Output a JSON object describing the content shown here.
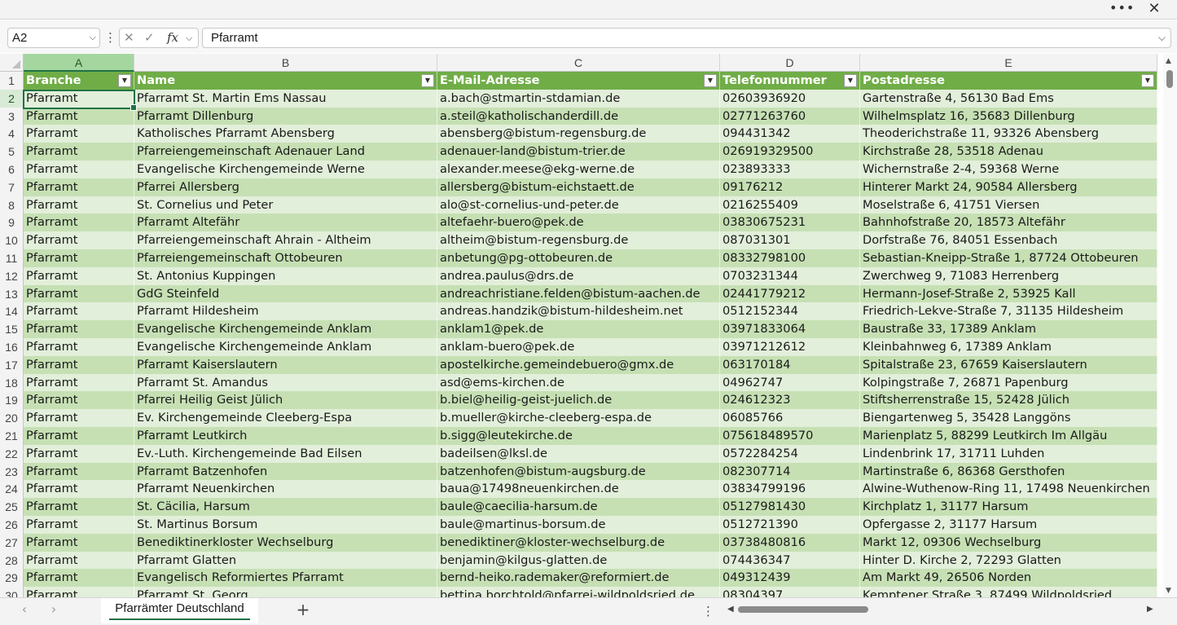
{
  "window": {
    "more_icon": "more-horizontal-icon",
    "close_icon": "close-icon"
  },
  "formula_bar": {
    "name_box": "A2",
    "fx_label": "fx",
    "formula": "Pfarramt"
  },
  "columns": [
    "A",
    "B",
    "C",
    "D",
    "E"
  ],
  "headers": [
    "Branche",
    "Name",
    "E-Mail-Adresse",
    "Telefonnummer",
    "Postadresse"
  ],
  "rows": [
    {
      "n": "2",
      "a": "Pfarramt",
      "b": "Pfarramt St. Martin Ems Nassau",
      "c": "a.bach@stmartin-stdamian.de",
      "d": "02603936920",
      "e": "Gartenstraße 4, 56130 Bad Ems"
    },
    {
      "n": "3",
      "a": "Pfarramt",
      "b": "Pfarramt Dillenburg",
      "c": "a.steil@katholischanderdill.de",
      "d": "02771263760",
      "e": "Wilhelmsplatz 16, 35683 Dillenburg"
    },
    {
      "n": "4",
      "a": "Pfarramt",
      "b": "Katholisches Pfarramt Abensberg",
      "c": "abensberg@bistum-regensburg.de",
      "d": "094431342",
      "e": "Theoderichstraße 11, 93326 Abensberg"
    },
    {
      "n": "5",
      "a": "Pfarramt",
      "b": "Pfarreiengemeinschaft Adenauer Land",
      "c": "adenauer-land@bistum-trier.de",
      "d": "026919329500",
      "e": "Kirchstraße 28, 53518 Adenau"
    },
    {
      "n": "6",
      "a": "Pfarramt",
      "b": "Evangelische Kirchengemeinde Werne",
      "c": "alexander.meese@ekg-werne.de",
      "d": "023893333",
      "e": "Wichernstraße 2-4, 59368 Werne"
    },
    {
      "n": "7",
      "a": "Pfarramt",
      "b": "Pfarrei Allersberg",
      "c": "allersberg@bistum-eichstaett.de",
      "d": "09176212",
      "e": "Hinterer Markt 24, 90584 Allersberg"
    },
    {
      "n": "8",
      "a": "Pfarramt",
      "b": "St. Cornelius und Peter",
      "c": "alo@st-cornelius-und-peter.de",
      "d": "0216255409",
      "e": "Moselstraße 6, 41751 Viersen"
    },
    {
      "n": "9",
      "a": "Pfarramt",
      "b": "Pfarramt Altefähr",
      "c": "altefaehr-buero@pek.de",
      "d": "03830675231",
      "e": "Bahnhofstraße 20, 18573 Altefähr"
    },
    {
      "n": "10",
      "a": "Pfarramt",
      "b": "Pfarreiengemeinschaft Ahrain - Altheim",
      "c": "altheim@bistum-regensburg.de",
      "d": "087031301",
      "e": "Dorfstraße 76, 84051 Essenbach"
    },
    {
      "n": "11",
      "a": "Pfarramt",
      "b": "Pfarreiengemeinschaft Ottobeuren",
      "c": "anbetung@pg-ottobeuren.de",
      "d": "08332798100",
      "e": "Sebastian-Kneipp-Straße 1, 87724 Ottobeuren"
    },
    {
      "n": "12",
      "a": "Pfarramt",
      "b": "St. Antonius Kuppingen",
      "c": "andrea.paulus@drs.de",
      "d": "0703231344",
      "e": "Zwerchweg 9, 71083 Herrenberg"
    },
    {
      "n": "13",
      "a": "Pfarramt",
      "b": "GdG Steinfeld",
      "c": "andreachristiane.felden@bistum-aachen.de",
      "d": "02441779212",
      "e": "Hermann-Josef-Straße 2, 53925 Kall"
    },
    {
      "n": "14",
      "a": "Pfarramt",
      "b": "Pfarramt Hildesheim",
      "c": "andreas.handzik@bistum-hildesheim.net",
      "d": "0512152344",
      "e": "Friedrich-Lekve-Straße 7, 31135 Hildesheim"
    },
    {
      "n": "15",
      "a": "Pfarramt",
      "b": "Evangelische Kirchengemeinde Anklam",
      "c": "anklam1@pek.de",
      "d": "03971833064",
      "e": "Baustraße 33, 17389 Anklam"
    },
    {
      "n": "16",
      "a": "Pfarramt",
      "b": "Evangelische Kirchengemeinde Anklam",
      "c": "anklam-buero@pek.de",
      "d": "03971212612",
      "e": "Kleinbahnweg 6, 17389 Anklam"
    },
    {
      "n": "17",
      "a": "Pfarramt",
      "b": "Pfarramt Kaiserslautern",
      "c": "apostelkirche.gemeindebuero@gmx.de",
      "d": "063170184",
      "e": "Spitalstraße 23, 67659 Kaiserslautern"
    },
    {
      "n": "18",
      "a": "Pfarramt",
      "b": "Pfarramt St. Amandus",
      "c": "asd@ems-kirchen.de",
      "d": "04962747",
      "e": "Kolpingstraße 7, 26871 Papenburg"
    },
    {
      "n": "19",
      "a": "Pfarramt",
      "b": "Pfarrei Heilig Geist Jülich",
      "c": "b.biel@heilig-geist-juelich.de",
      "d": "024612323",
      "e": "Stiftsherrenstraße 15, 52428 Jülich"
    },
    {
      "n": "20",
      "a": "Pfarramt",
      "b": "Ev. Kirchengemeinde Cleeberg-Espa",
      "c": "b.mueller@kirche-cleeberg-espa.de",
      "d": "06085766",
      "e": "Biengartenweg 5, 35428 Langgöns"
    },
    {
      "n": "21",
      "a": "Pfarramt",
      "b": "Pfarramt Leutkirch",
      "c": "b.sigg@leutekirche.de",
      "d": "075618489570",
      "e": "Marienplatz 5, 88299 Leutkirch Im Allgäu"
    },
    {
      "n": "22",
      "a": "Pfarramt",
      "b": "Ev.-Luth. Kirchengemeinde Bad Eilsen",
      "c": "badeilsen@lksl.de",
      "d": "0572284254",
      "e": "Lindenbrink 17, 31711 Luhden"
    },
    {
      "n": "23",
      "a": "Pfarramt",
      "b": "Pfarramt Batzenhofen",
      "c": "batzenhofen@bistum-augsburg.de",
      "d": "082307714",
      "e": "Martinstraße 6, 86368 Gersthofen"
    },
    {
      "n": "24",
      "a": "Pfarramt",
      "b": "Pfarramt Neuenkirchen",
      "c": "baua@17498neuenkirchen.de",
      "d": "03834799196",
      "e": "Alwine-Wuthenow-Ring 11, 17498 Neuenkirchen"
    },
    {
      "n": "25",
      "a": "Pfarramt",
      "b": "St. Cäcilia, Harsum",
      "c": "baule@caecilia-harsum.de",
      "d": "05127981430",
      "e": "Kirchplatz 1, 31177 Harsum"
    },
    {
      "n": "26",
      "a": "Pfarramt",
      "b": "St. Martinus Borsum",
      "c": "baule@martinus-borsum.de",
      "d": "0512721390",
      "e": "Opfergasse 2, 31177 Harsum"
    },
    {
      "n": "27",
      "a": "Pfarramt",
      "b": "Benediktinerkloster Wechselburg",
      "c": "benediktiner@kloster-wechselburg.de",
      "d": "03738480816",
      "e": "Markt 12, 09306 Wechselburg"
    },
    {
      "n": "28",
      "a": "Pfarramt",
      "b": "Pfarramt Glatten",
      "c": "benjamin@kilgus-glatten.de",
      "d": "074436347",
      "e": "Hinter D. Kirche 2, 72293 Glatten"
    },
    {
      "n": "29",
      "a": "Pfarramt",
      "b": "Evangelisch Reformiertes Pfarramt",
      "c": "bernd-heiko.rademaker@reformiert.de",
      "d": "049312439",
      "e": "Am Markt 49, 26506 Norden"
    },
    {
      "n": "30",
      "a": "Pfarramt",
      "b": "Pfarramt St. Georg",
      "c": "bettina.borchtold@pfarrei-wildpoldsried.de",
      "d": "08304397",
      "e": "Kemptener Straße 3, 87499 Wildpoldsried"
    }
  ],
  "sheet_tabs": [
    {
      "label": "Pfarrämter Deutschland",
      "active": true
    }
  ],
  "colors": {
    "header_green": "#70ad47",
    "band_light": "#e2efda",
    "band_dark": "#c6e0b4",
    "accent": "#217346"
  }
}
